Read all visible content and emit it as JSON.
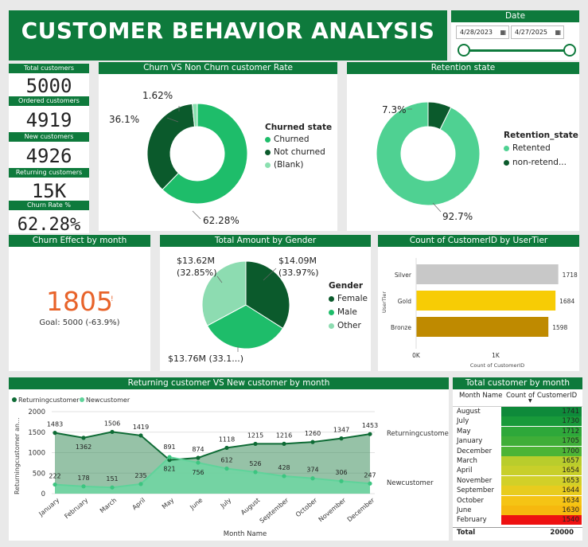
{
  "header": {
    "title": "CUSTOMER BEHAVIOR ANALYSIS"
  },
  "date_filter": {
    "label": "Date",
    "start": "4/28/2023",
    "end": "4/27/2025"
  },
  "kpis": [
    {
      "label": "Total customers",
      "value": "5000"
    },
    {
      "label": "Ordered customers",
      "value": "4919"
    },
    {
      "label": "New customers",
      "value": "4926"
    },
    {
      "label": "Returning customers",
      "value": "15K"
    },
    {
      "label": "Churn Rate %",
      "value": "62.28%"
    }
  ],
  "churn_card": {
    "title": "Churn VS Non Churn customer Rate",
    "legend_title": "Churned state",
    "legend": [
      {
        "name": "Churned",
        "color": "#1ebd6a"
      },
      {
        "name": "Not churned",
        "color": "#0b5a2c"
      },
      {
        "name": "(Blank)",
        "color": "#8be0b0"
      }
    ],
    "labels": {
      "churned": "62.28%",
      "not_churned": "36.1%",
      "blank": "1.62%"
    }
  },
  "retention_card": {
    "title": "Retention state",
    "legend_title": "Retention_state",
    "legend": [
      {
        "name": "Retented",
        "color": "#4fd192"
      },
      {
        "name": "non-retend...",
        "color": "#0b5a2c"
      }
    ],
    "labels": {
      "retented": "92.7%",
      "non_retended": "7.3%"
    }
  },
  "churn_effect": {
    "title": "Churn Effect by month",
    "value": "1805",
    "goal": "Goal: 5000 (-63.9%)",
    "value_color": "#e8632a"
  },
  "gender_card": {
    "title": "Total Amount by Gender",
    "legend_title": "Gender",
    "legend": [
      {
        "name": "Female",
        "color": "#0b5a2c"
      },
      {
        "name": "Male",
        "color": "#1ebd6a"
      },
      {
        "name": "Other",
        "color": "#8ddcb1"
      }
    ],
    "labels": {
      "female_value": "$14.09M",
      "female_pct": "(33.97%)",
      "other_value": "$13.62M",
      "other_pct": "(32.85%)",
      "male": "$13.76M (33.1...)"
    }
  },
  "usertier_card": {
    "title": "Count of CustomerID by UserTier",
    "y_axis_title": "UserTier",
    "x_axis_title": "Count of CustomerID",
    "x_ticks": [
      "0K",
      "1K"
    ]
  },
  "line_card": {
    "title": "Returning customer VS New customer by month",
    "y_axis_title": "Returningcustomer an...",
    "x_axis_title": "Month Name",
    "end_label_returning": "Returningcustomer",
    "end_label_new": "Newcustomer",
    "y_ticks": [
      "0",
      "500",
      "1000",
      "1500",
      "2000"
    ]
  },
  "total_by_month": {
    "title": "Total customer by month",
    "col_month": "Month Name",
    "col_count": "Count of CustomerID",
    "rows": [
      {
        "month": "August",
        "count": "1741",
        "color": "#0e8a3a"
      },
      {
        "month": "July",
        "count": "1730",
        "color": "#189a3a"
      },
      {
        "month": "May",
        "count": "1712",
        "color": "#2ea83a"
      },
      {
        "month": "January",
        "count": "1705",
        "color": "#3fae38"
      },
      {
        "month": "December",
        "count": "1700",
        "color": "#4cb436"
      },
      {
        "month": "March",
        "count": "1657",
        "color": "#b9cd2c"
      },
      {
        "month": "April",
        "count": "1654",
        "color": "#c8cf2a"
      },
      {
        "month": "November",
        "count": "1653",
        "color": "#d2d028"
      },
      {
        "month": "September",
        "count": "1644",
        "color": "#e8cc1e"
      },
      {
        "month": "October",
        "count": "1634",
        "color": "#f5c414"
      },
      {
        "month": "June",
        "count": "1630",
        "color": "#f6b80e"
      },
      {
        "month": "February",
        "count": "1540",
        "color": "#ee1111"
      }
    ],
    "total_label": "Total",
    "total_value": "20000"
  },
  "chart_data": [
    {
      "type": "pie",
      "title": "Churn VS Non Churn customer Rate",
      "variant": "donut",
      "categories": [
        "Churned",
        "Not churned",
        "(Blank)"
      ],
      "values": [
        62.28,
        36.1,
        1.62
      ]
    },
    {
      "type": "pie",
      "title": "Retention state",
      "variant": "donut",
      "categories": [
        "Retented",
        "non-retend..."
      ],
      "values": [
        92.7,
        7.3
      ]
    },
    {
      "type": "pie",
      "title": "Total Amount by Gender",
      "categories": [
        "Female",
        "Male",
        "Other"
      ],
      "values": [
        14.09,
        13.76,
        13.62
      ],
      "percents": [
        33.97,
        33.1,
        32.85
      ]
    },
    {
      "type": "bar",
      "title": "Count of CustomerID by UserTier",
      "orientation": "horizontal",
      "categories": [
        "Silver",
        "Gold",
        "Bronze"
      ],
      "values": [
        1718,
        1684,
        1598
      ],
      "colors": [
        "#c8c8c8",
        "#f7cc05",
        "#bf8a00"
      ],
      "xlabel": "Count of CustomerID",
      "ylabel": "UserTier",
      "xlim": [
        0,
        1800
      ]
    },
    {
      "type": "area",
      "title": "Returning customer VS New customer by month",
      "categories": [
        "January",
        "February",
        "March",
        "April",
        "May",
        "June",
        "July",
        "August",
        "September",
        "October",
        "November",
        "December"
      ],
      "series": [
        {
          "name": "Returningcustomer",
          "color": "#0e6b35",
          "values": [
            1483,
            1362,
            1506,
            1419,
            821,
            874,
            1118,
            1215,
            1216,
            1260,
            1347,
            1453
          ]
        },
        {
          "name": "Newcustomer",
          "color": "#5fd39a",
          "values": [
            222,
            178,
            151,
            235,
            891,
            756,
            612,
            526,
            428,
            374,
            306,
            247
          ]
        }
      ],
      "xlabel": "Month Name",
      "ylabel": "Returningcustomer an...",
      "ylim": [
        0,
        2000
      ],
      "legend": "top-left"
    }
  ]
}
